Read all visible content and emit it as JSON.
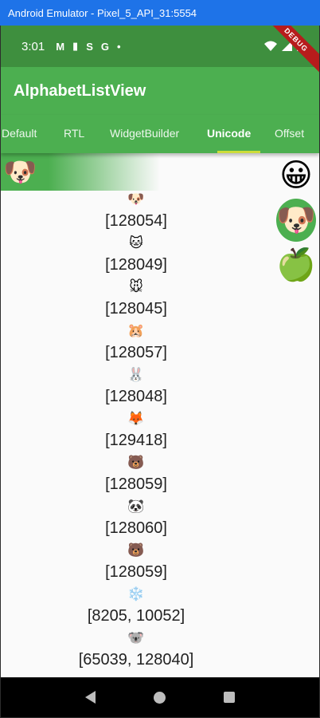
{
  "window": {
    "title": "Android Emulator - Pixel_5_API_31:5554"
  },
  "status_bar": {
    "time": "3:01",
    "icons": [
      "M",
      "▮",
      "S",
      "G",
      "•"
    ],
    "debug_label": "DEBUG"
  },
  "app_bar": {
    "title": "AlphabetListView"
  },
  "tabs": [
    {
      "label": "Default"
    },
    {
      "label": "RTL"
    },
    {
      "label": "WidgetBuilder"
    },
    {
      "label": "Unicode"
    },
    {
      "label": "Offset"
    }
  ],
  "header": {
    "emoji": "🐶"
  },
  "list": [
    {
      "emoji": "🐶",
      "code": "[128054]"
    },
    {
      "emoji": "🐱",
      "code": "[128049]"
    },
    {
      "emoji": "🐭",
      "code": "[128045]"
    },
    {
      "emoji": "🐹",
      "code": "[128057]"
    },
    {
      "emoji": "🐰",
      "code": "[128048]"
    },
    {
      "emoji": "🦊",
      "code": "[129418]"
    },
    {
      "emoji": "🐻",
      "code": "[128059]"
    },
    {
      "emoji": "🐼",
      "code": "[128060]"
    },
    {
      "emoji": "🐻",
      "code": "[128059]"
    },
    {
      "emoji": "❄️",
      "code": "[8205, 10052]"
    },
    {
      "emoji": "🐨",
      "code": "[65039, 128040]"
    }
  ],
  "sidebar": [
    {
      "emoji": "😀"
    },
    {
      "emoji": "🐶"
    },
    {
      "emoji": "🍏"
    }
  ]
}
